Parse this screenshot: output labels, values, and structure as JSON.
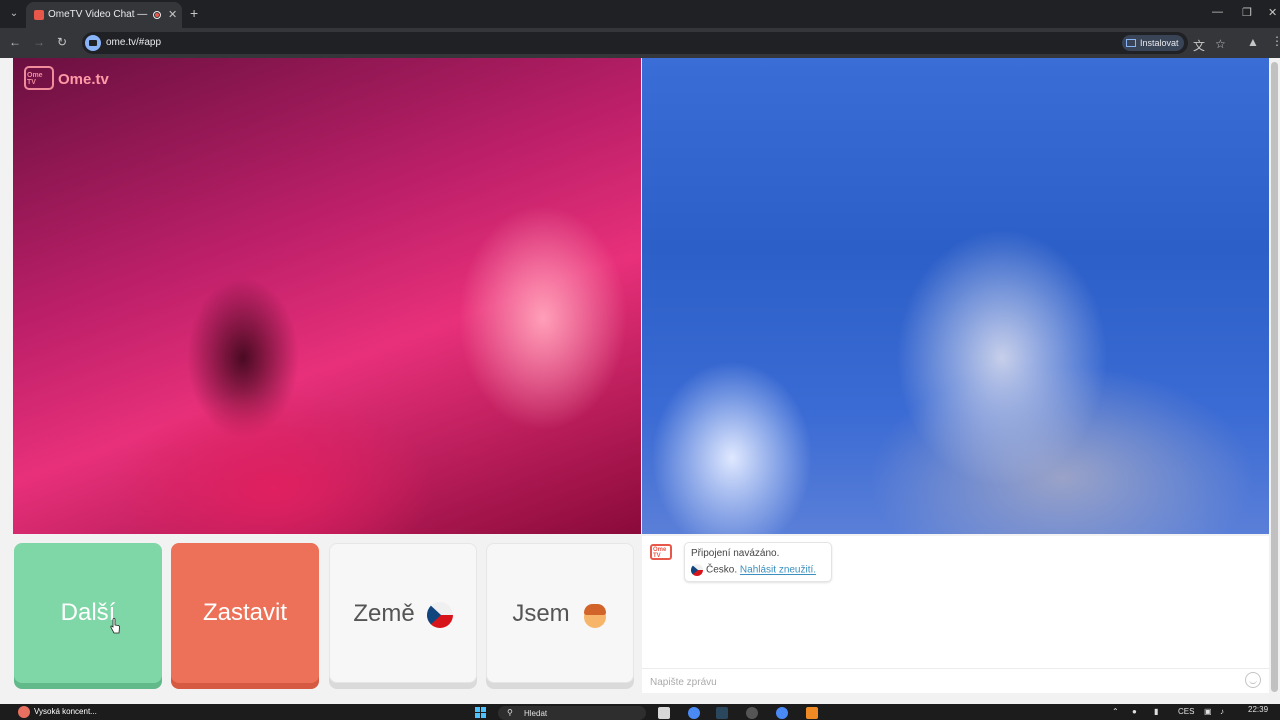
{
  "browser": {
    "tab_title": "OmeTV Video Chat — Ome",
    "url": "ome.tv/#app",
    "install_label": "Instalovat"
  },
  "video": {
    "logo_text": "Ome.tv"
  },
  "controls": {
    "next_label": "Další",
    "stop_label": "Zastavit",
    "country_label": "Země",
    "gender_label": "Jsem"
  },
  "chat": {
    "connected_text": "Připojení navázáno.",
    "country_text": "Česko.",
    "report_link": "Nahlásit zneužití.",
    "input_placeholder": "Napište zprávu"
  },
  "taskbar": {
    "notification_text": "Vysoká koncent...",
    "search_placeholder": "Hledat",
    "language": "CES",
    "time": "22:39"
  }
}
